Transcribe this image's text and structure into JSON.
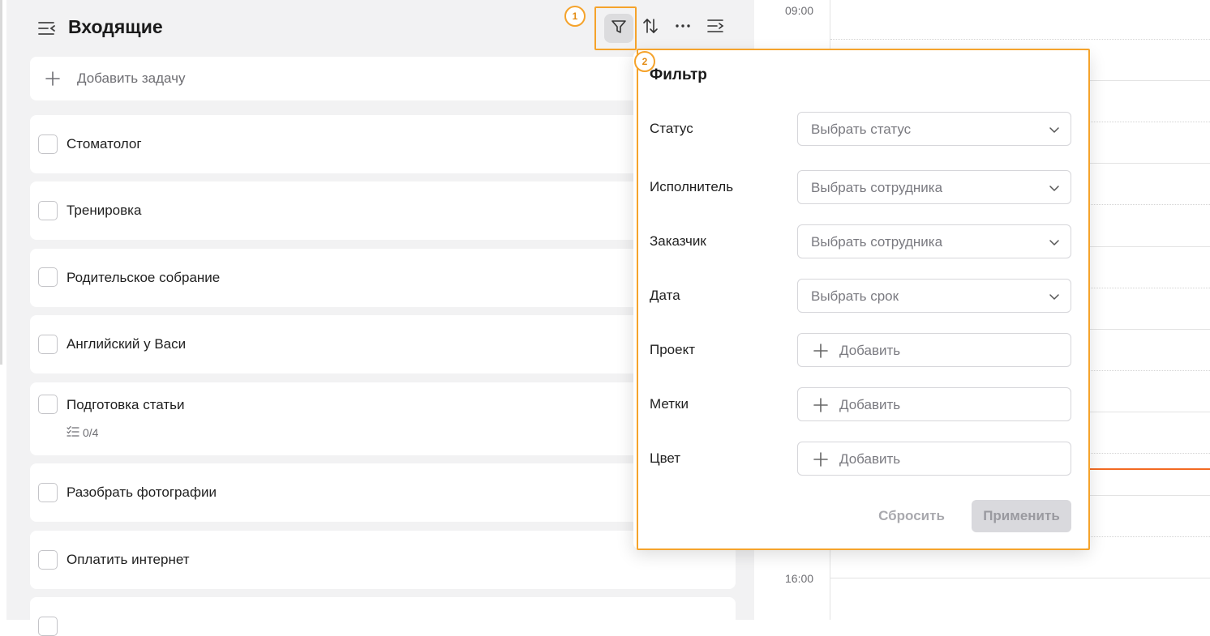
{
  "header": {
    "title": "Входящие"
  },
  "add_task": {
    "label": "Добавить задачу"
  },
  "tasks": [
    {
      "title": "Стоматолог"
    },
    {
      "title": "Тренировка"
    },
    {
      "title": "Родительское собрание"
    },
    {
      "title": "Английский у Васи"
    },
    {
      "title": "Подготовка статьи",
      "subtasks": "0/4"
    },
    {
      "title": "Разобрать фотографии"
    },
    {
      "title": "Оплатить интернет"
    }
  ],
  "markers": {
    "one": "1",
    "two": "2"
  },
  "filter": {
    "title": "Фильтр",
    "fields": [
      {
        "label": "Статус",
        "placeholder": "Выбрать статус",
        "kind": "select"
      },
      {
        "label": "Исполнитель",
        "placeholder": "Выбрать сотрудника",
        "kind": "select"
      },
      {
        "label": "Заказчик",
        "placeholder": "Выбрать сотрудника",
        "kind": "select"
      },
      {
        "label": "Дата",
        "placeholder": "Выбрать срок",
        "kind": "select"
      },
      {
        "label": "Проект",
        "placeholder": "Добавить",
        "kind": "add"
      },
      {
        "label": "Метки",
        "placeholder": "Добавить",
        "kind": "add"
      },
      {
        "label": "Цвет",
        "placeholder": "Добавить",
        "kind": "add"
      }
    ],
    "reset_label": "Сбросить",
    "apply_label": "Применить"
  },
  "calendar": {
    "hours": [
      "09:00",
      "16:00"
    ]
  },
  "colors": {
    "highlight": "#f5a32b",
    "now_line": "#f26a22",
    "pane_bg": "#f2f2f3"
  },
  "icons": {
    "menu": "list-collapse-icon",
    "filter": "funnel-icon",
    "sort": "sort-arrows-icon",
    "more": "more-horizontal-icon",
    "collapse": "list-expand-icon",
    "add": "plus-icon",
    "dropdown": "chevron-down-icon",
    "subtasks": "checklist-icon"
  }
}
